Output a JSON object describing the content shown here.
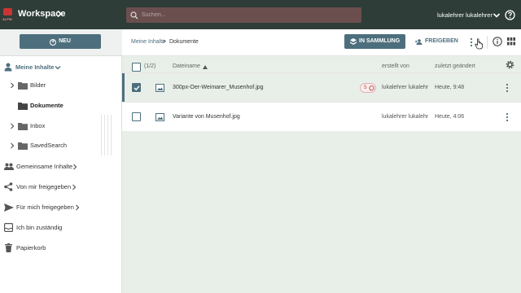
{
  "header": {
    "logo_text": "ALFIN",
    "app_title": "Workspace",
    "search_placeholder": "Suchen...",
    "user_name": "lukalehrer lukalehrer"
  },
  "actions": {
    "new_label": "NEU",
    "collection_label": "IN SAMMLUNG",
    "share_label": "FREIGEBEN"
  },
  "breadcrumb": {
    "parent": "Meine Inhalte",
    "separator": ">",
    "current": "Dokumente"
  },
  "sidebar": {
    "my_content": "Meine Inhalte",
    "folders": [
      "Bilder",
      "Dokumente",
      "Inbox",
      "SavedSearch"
    ],
    "shared_content": "Gemeinsame Inhalte",
    "shared_by_me": "Von mir freigegeben",
    "shared_with_me": "Für mich freigegeben",
    "responsible": "Ich bin zuständig",
    "trash": "Papierkorb"
  },
  "table": {
    "selection_count": "(1/2)",
    "columns": {
      "name": "Dateiname",
      "created_by": "erstellt von",
      "modified": "zuletzt geändert"
    },
    "rows": [
      {
        "name": "300px-Oer-Weimarer_Musenhof.jpg",
        "comments": "5",
        "created_by": "lukalehrer lukalehr",
        "modified": "Heute, 9:48",
        "selected": true
      },
      {
        "name": "Variante von Musenhof.jpg",
        "comments": "",
        "created_by": "lukalehrer lukalehr",
        "modified": "Heute, 4:06",
        "selected": false
      }
    ]
  },
  "colors": {
    "header_bg": "#2e3d38",
    "accent": "#4d6f7d",
    "search_bg": "#6b4f4f",
    "selection_bg": "#e8efe9"
  }
}
